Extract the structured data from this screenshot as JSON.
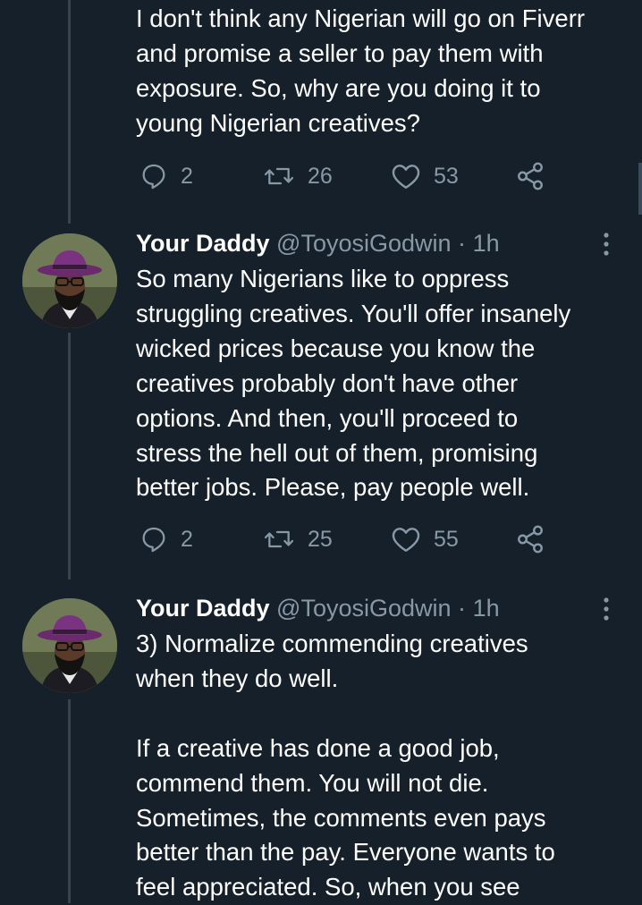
{
  "tweets": [
    {
      "text": "I don't think any Nigerian will go on Fiverr\nand promise a seller to pay them with\nexposure. So, why are you doing it to\nyoung Nigerian creatives?",
      "replies": "2",
      "retweets": "26",
      "likes": "53"
    },
    {
      "name": "Your Daddy",
      "handle": "@ToyosiGodwin",
      "separator": "·",
      "time": "1h",
      "text": "So many Nigerians like to oppress\nstruggling creatives. You'll offer insanely\nwicked prices because you know the\ncreatives probably don't have other\noptions. And then, you'll proceed to\nstress the hell out of them, promising\nbetter jobs. Please, pay people well.",
      "replies": "2",
      "retweets": "25",
      "likes": "55"
    },
    {
      "name": "Your Daddy",
      "handle": "@ToyosiGodwin",
      "separator": "·",
      "time": "1h",
      "text": "3) Normalize commending creatives\nwhen they do well.\n\nIf a creative has done a good job,\ncommend them. You will not die.\nSometimes, the comments even pays\nbetter than the pay. Everyone wants to\nfeel appreciated. So, when you see"
    }
  ],
  "icons": {
    "reply": "reply-icon",
    "retweet": "retweet-icon",
    "like": "heart-icon",
    "share": "share-icon",
    "more": "more-vertical-icon"
  },
  "colors": {
    "background": "#15202b",
    "secondary_text": "#8899a6",
    "thread_line": "#38444d"
  }
}
